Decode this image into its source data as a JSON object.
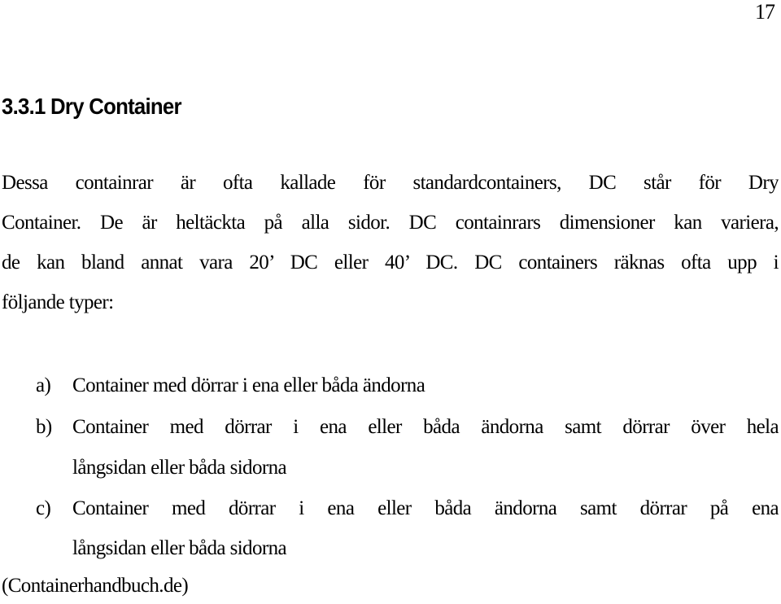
{
  "page": {
    "number": "17"
  },
  "section": {
    "heading": "3.3.1 Dry Container"
  },
  "paragraph": {
    "lines": [
      "Dessa containrar är ofta kallade för standardcontainers, DC står för Dry",
      "Container. De är heltäckta på alla sidor. DC containrars dimensioner kan variera,",
      "de kan bland annat vara 20’ DC eller 40’ DC. DC containers räknas ofta upp i",
      "följande typer:"
    ]
  },
  "list": {
    "items": [
      {
        "marker": "a)",
        "lines": [
          "Container med dörrar i ena eller båda ändorna"
        ]
      },
      {
        "marker": "b)",
        "lines": [
          "Container med dörrar i ena eller båda ändorna samt dörrar över hela",
          "långsidan eller båda sidorna"
        ]
      },
      {
        "marker": "c)",
        "lines": [
          "Container med dörrar i ena eller båda ändorna samt dörrar på ena",
          "långsidan eller båda sidorna"
        ]
      }
    ]
  },
  "source": {
    "text": "(Containerhandbuch.de)"
  }
}
